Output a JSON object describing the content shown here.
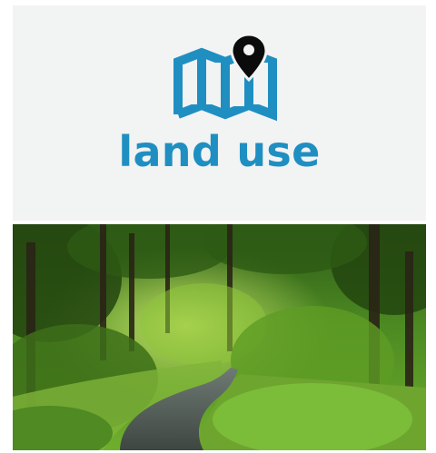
{
  "tile": {
    "title": "land use",
    "icon": "map-with-pin-icon",
    "image": "forest-path-photo"
  },
  "colors": {
    "accent": "#1f8fc2",
    "pin": "#0b0b0b",
    "header_bg": "#f2f3f3"
  }
}
